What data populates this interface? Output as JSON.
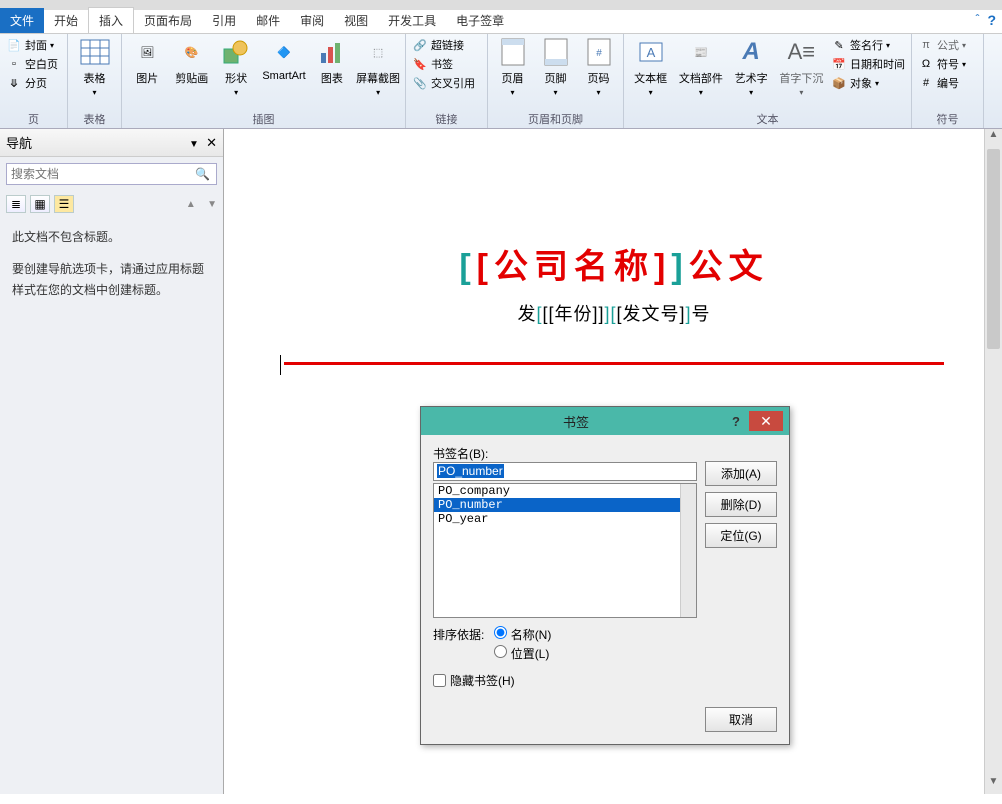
{
  "tabs": {
    "file": "文件",
    "home": "开始",
    "insert": "插入",
    "layout": "页面布局",
    "references": "引用",
    "mailings": "邮件",
    "review": "审阅",
    "view": "视图",
    "developer": "开发工具",
    "esign": "电子签章"
  },
  "ribbon": {
    "pages": {
      "cover": "封面",
      "blank": "空白页",
      "break": "分页",
      "label": "页"
    },
    "tables": {
      "table": "表格",
      "label": "表格"
    },
    "illustrations": {
      "picture": "图片",
      "clipart": "剪贴画",
      "shapes": "形状",
      "smartart": "SmartArt",
      "chart": "图表",
      "screenshot": "屏幕截图",
      "label": "插图"
    },
    "links": {
      "hyperlink": "超链接",
      "bookmark": "书签",
      "crossref": "交叉引用",
      "label": "链接"
    },
    "headerfooter": {
      "header": "页眉",
      "footer": "页脚",
      "pagenum": "页码",
      "label": "页眉和页脚"
    },
    "text": {
      "textbox": "文本框",
      "quickparts": "文档部件",
      "wordart": "艺术字",
      "dropcap": "首字下沉",
      "sigline": "签名行",
      "datetime": "日期和时间",
      "object": "对象",
      "label": "文本"
    },
    "symbols": {
      "equation": "公式",
      "symbol": "符号",
      "number": "编号",
      "label": "符号"
    }
  },
  "nav": {
    "title": "导航",
    "search_placeholder": "搜索文档",
    "msg1": "此文档不包含标题。",
    "msg2": "要创建导航选项卡，请通过应用标题样式在您的文档中创建标题。"
  },
  "document": {
    "title_prefix": "[公司名称]",
    "title_suffix": "公文",
    "subtitle_pre": "发",
    "year_ph": "[[年份]]",
    "num_ph": "[发文号]",
    "subtitle_post": "号"
  },
  "dialog": {
    "title": "书签",
    "name_label": "书签名(B):",
    "name_value": "PO_number",
    "items": [
      "PO_company",
      "PO_number",
      "PO_year"
    ],
    "selected_index": 1,
    "add": "添加(A)",
    "delete": "删除(D)",
    "goto": "定位(G)",
    "sort_label": "排序依据:",
    "sort_name": "名称(N)",
    "sort_location": "位置(L)",
    "hidden": "隐藏书签(H)",
    "cancel": "取消"
  }
}
